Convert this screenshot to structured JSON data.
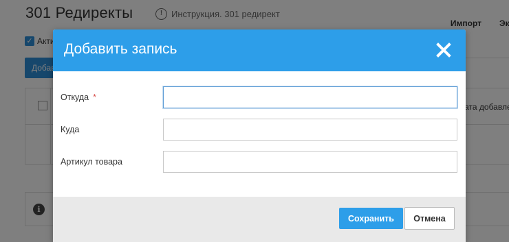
{
  "page": {
    "title": "301 Редиректы",
    "instruction_link": "Инструкция. 301 редирект",
    "top_links": [
      "Импорт",
      "Экспорт"
    ],
    "active_label": "Активные",
    "add_button": "Добавить",
    "table_header_col": "Дата добавления"
  },
  "modal": {
    "title": "Добавить запись",
    "close_icon": "close-icon",
    "fields": [
      {
        "label": "Откуда",
        "required_mark": "*",
        "value": "",
        "placeholder": ""
      },
      {
        "label": "Куда",
        "value": "",
        "placeholder": ""
      },
      {
        "label": "Артикул товара",
        "value": "",
        "placeholder": ""
      }
    ],
    "save_label": "Сохранить",
    "cancel_label": "Отмена"
  },
  "colors": {
    "accent": "#2d9ee9",
    "required": "#d9534f",
    "footer_bg": "#e9e9e9"
  }
}
